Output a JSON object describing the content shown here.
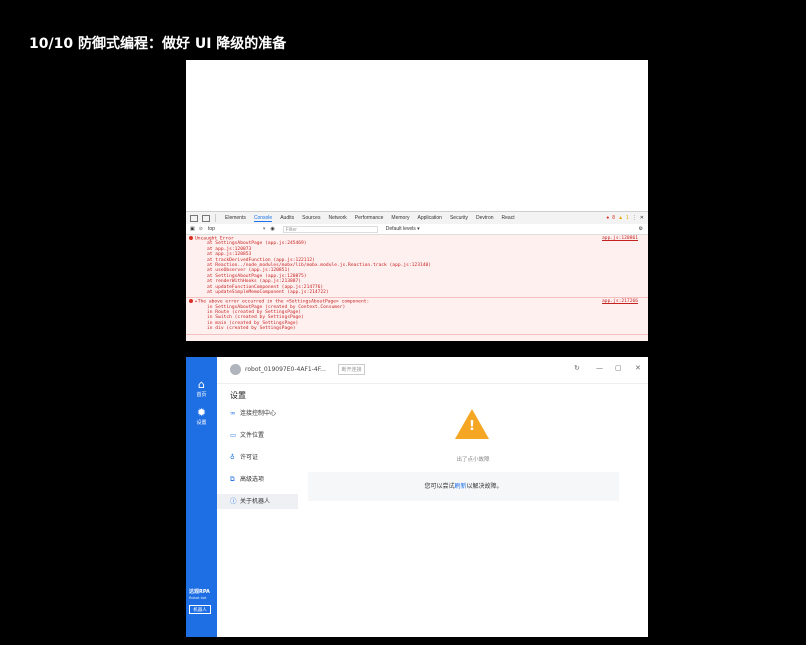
{
  "slide": {
    "title": "10/10 防御式编程：做好 UI 降级的准备"
  },
  "devtools": {
    "tabs": [
      "Elements",
      "Console",
      "Audits",
      "Sources",
      "Network",
      "Performance",
      "Memory",
      "Application",
      "Security",
      "Devtron",
      "React"
    ],
    "active_tab": "Console",
    "error_count": "8",
    "warning_count": "1",
    "context": "top",
    "filter_placeholder": "Filter",
    "levels": "Default levels ▾",
    "errors": [
      {
        "lines": [
          "Uncaught Error",
          "at SettingsAboutPage (app.js:245469)",
          "at app.js:120873",
          "at app.js:120853",
          "at trackDerivedFunction (app.js:122112)",
          "at Reaction../node_modules/mobx/lib/mobx.module.js.Reaction.track (app.js:123140)",
          "at useObserver (app.js:120851)",
          "at SettingsAboutPage (app.js:120875)",
          "at renderWithHooks (app.js:213887)",
          "at updateFunctionComponent (app.js:214776)",
          "at updateSimpleMemoComponent (app.js:214722)"
        ],
        "source": "app.js:120861"
      },
      {
        "lines": [
          "▸The above error occurred in the <SettingsAboutPage> component:",
          "in SettingsAboutPage (created by Context.Consumer)",
          "in Route (created by SettingsPage)",
          "in Switch (created by SettingsPage)",
          "in main (created by SettingsPage)",
          "in div (created by SettingsPage)"
        ],
        "source": "app.js:217266"
      }
    ]
  },
  "app": {
    "nav": [
      {
        "label": "首页",
        "icon": "home-icon"
      },
      {
        "label": "设置",
        "icon": "gear-icon"
      }
    ],
    "brand": "达观RPA",
    "brand_sub": "Robot bot",
    "robot_button": "机器人",
    "robot_name": "robot_019097E0-4AF1-4F...",
    "disconnect_label": "断开连接",
    "settings_title": "设置",
    "menu": [
      {
        "label": "连接控制中心",
        "icon": "link-icon"
      },
      {
        "label": "文件位置",
        "icon": "folder-icon"
      },
      {
        "label": "许可证",
        "icon": "key-icon"
      },
      {
        "label": "高级选项",
        "icon": "options-icon"
      },
      {
        "label": "关于机器人",
        "icon": "info-icon"
      }
    ],
    "error_caption": "出了点小故障",
    "hint_before": "您可以尝试",
    "hint_link": "刷新",
    "hint_after": "以解决故障。",
    "colors": {
      "sidebar": "#1e6fe4",
      "warning": "#f5a623",
      "error_bg": "#fff0f0"
    }
  }
}
